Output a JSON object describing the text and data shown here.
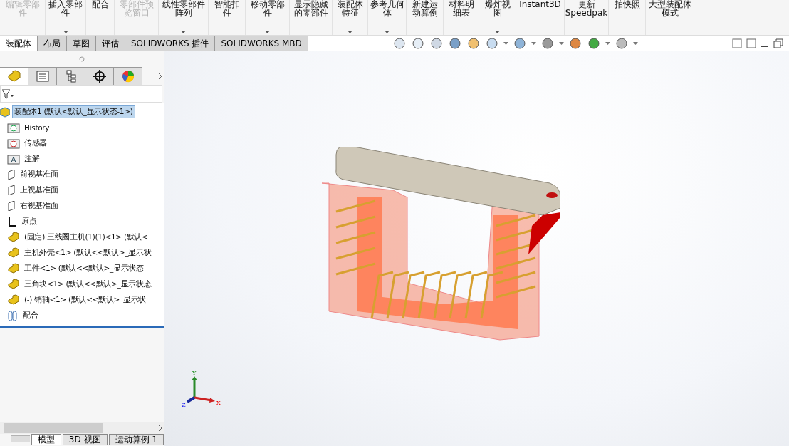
{
  "ribbon": [
    {
      "label": "编辑零部件",
      "disabled": true,
      "dropdown": false
    },
    {
      "label": "插入零部件",
      "disabled": false,
      "dropdown": true
    },
    {
      "label": "配合",
      "disabled": false,
      "dropdown": false
    },
    {
      "label": "零部件预览窗口",
      "disabled": true,
      "dropdown": false
    },
    {
      "label": "线性零部件阵列",
      "disabled": false,
      "dropdown": true
    },
    {
      "label": "智能扣件",
      "disabled": false,
      "dropdown": false
    },
    {
      "label": "移动零部件",
      "disabled": false,
      "dropdown": true
    },
    {
      "label": "显示隐藏的零部件",
      "disabled": false,
      "dropdown": false
    },
    {
      "label": "装配体特征",
      "disabled": false,
      "dropdown": true
    },
    {
      "label": "参考几何体",
      "disabled": false,
      "dropdown": true
    },
    {
      "label": "新建运动算例",
      "disabled": false,
      "dropdown": false
    },
    {
      "label": "材料明细表",
      "disabled": false,
      "dropdown": false
    },
    {
      "label": "爆炸视图",
      "disabled": false,
      "dropdown": true
    },
    {
      "label": "Instant3D",
      "disabled": false,
      "dropdown": false
    },
    {
      "label": "更新 Speedpak",
      "disabled": false,
      "dropdown": false
    },
    {
      "label": "拍快照",
      "disabled": false,
      "dropdown": false
    },
    {
      "label": "大型装配体模式",
      "disabled": false,
      "dropdown": false
    }
  ],
  "tabs": [
    {
      "label": "装配体",
      "selected": true
    },
    {
      "label": "布局",
      "selected": false
    },
    {
      "label": "草图",
      "selected": false
    },
    {
      "label": "评估",
      "selected": false
    },
    {
      "label": "SOLIDWORKS 插件",
      "selected": false
    },
    {
      "label": "SOLIDWORKS MBD",
      "selected": false
    }
  ],
  "tree": {
    "label": "装配体1  (默认<默认_显示状态-1>)",
    "selected": true,
    "children": [
      {
        "kind": "history",
        "label": "History"
      },
      {
        "kind": "sensor",
        "label": "传感器"
      },
      {
        "kind": "annotation",
        "label": "注解"
      },
      {
        "kind": "plane",
        "label": "前视基准面"
      },
      {
        "kind": "plane",
        "label": "上视基准面"
      },
      {
        "kind": "plane",
        "label": "右视基准面"
      },
      {
        "kind": "origin",
        "label": "原点"
      },
      {
        "kind": "part",
        "label": "(固定) 三线圈主机(1)(1)<1>  (默认<"
      },
      {
        "kind": "part",
        "label": "主机外壳<1>  (默认<<默认>_显示状"
      },
      {
        "kind": "part",
        "label": "工件<1>  (默认<<默认>_显示状态"
      },
      {
        "kind": "part",
        "label": "三角块<1>  (默认<<默认>_显示状态"
      },
      {
        "kind": "part",
        "label": "(-) 销轴<1>  (默认<<默认>_显示状"
      },
      {
        "kind": "mate",
        "label": "配合"
      }
    ]
  },
  "triad": {
    "x": "X",
    "y": "Y",
    "z": "Z"
  },
  "bottom_tabs": [
    {
      "label": "模型",
      "selected": true
    },
    {
      "label": "3D 视图",
      "selected": false
    },
    {
      "label": "运动算例 1",
      "selected": false
    }
  ]
}
